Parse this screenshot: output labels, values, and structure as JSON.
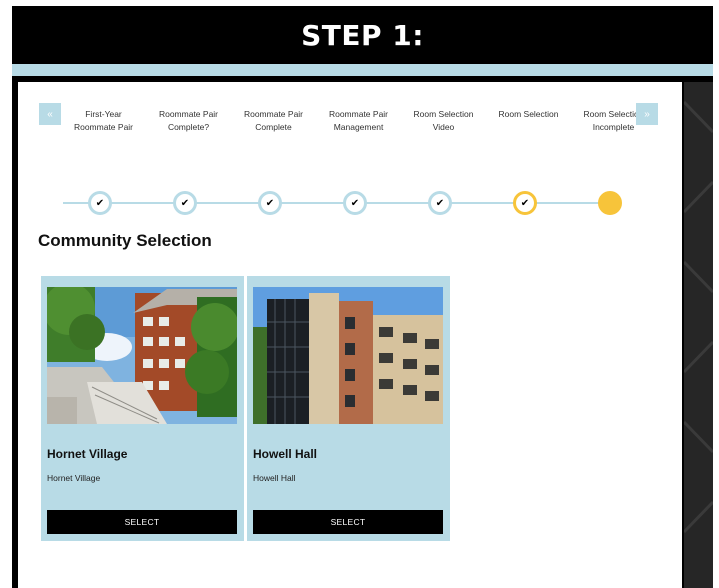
{
  "header": {
    "title": "STEP 1:"
  },
  "nav": {
    "prev_icon": "chevron-left-icon",
    "next_icon": "chevron-right-icon",
    "tabs": [
      {
        "line1": "First-Year",
        "line2": "Roommate Pair"
      },
      {
        "line1": "Roommate Pair",
        "line2": "Complete?"
      },
      {
        "line1": "Roommate Pair",
        "line2": "Complete"
      },
      {
        "line1": "Roommate Pair",
        "line2": "Management"
      },
      {
        "line1": "Room Selection",
        "line2": "Video"
      },
      {
        "line1": "Room Selection",
        "line2": ""
      },
      {
        "line1": "Room Selection",
        "line2": "Incomplete"
      }
    ]
  },
  "progress": {
    "steps": [
      {
        "state": "complete",
        "icon": "checkmark-icon"
      },
      {
        "state": "complete",
        "icon": "checkmark-icon"
      },
      {
        "state": "complete",
        "icon": "checkmark-icon"
      },
      {
        "state": "complete",
        "icon": "checkmark-icon"
      },
      {
        "state": "complete",
        "icon": "checkmark-icon"
      },
      {
        "state": "current",
        "icon": "checkmark-icon"
      },
      {
        "state": "upcoming"
      }
    ],
    "colors": {
      "track": "#b8dbe6",
      "active": "#f7c43a"
    }
  },
  "section": {
    "title": "Community Selection"
  },
  "cards": [
    {
      "name": "Hornet Village",
      "subtitle": "Hornet Village",
      "button": "SELECT"
    },
    {
      "name": "Howell Hall",
      "subtitle": "Howell Hall",
      "button": "SELECT"
    }
  ],
  "colors": {
    "accent": "#b8dbe6",
    "header_bg": "#000000",
    "highlight": "#f7c43a"
  }
}
